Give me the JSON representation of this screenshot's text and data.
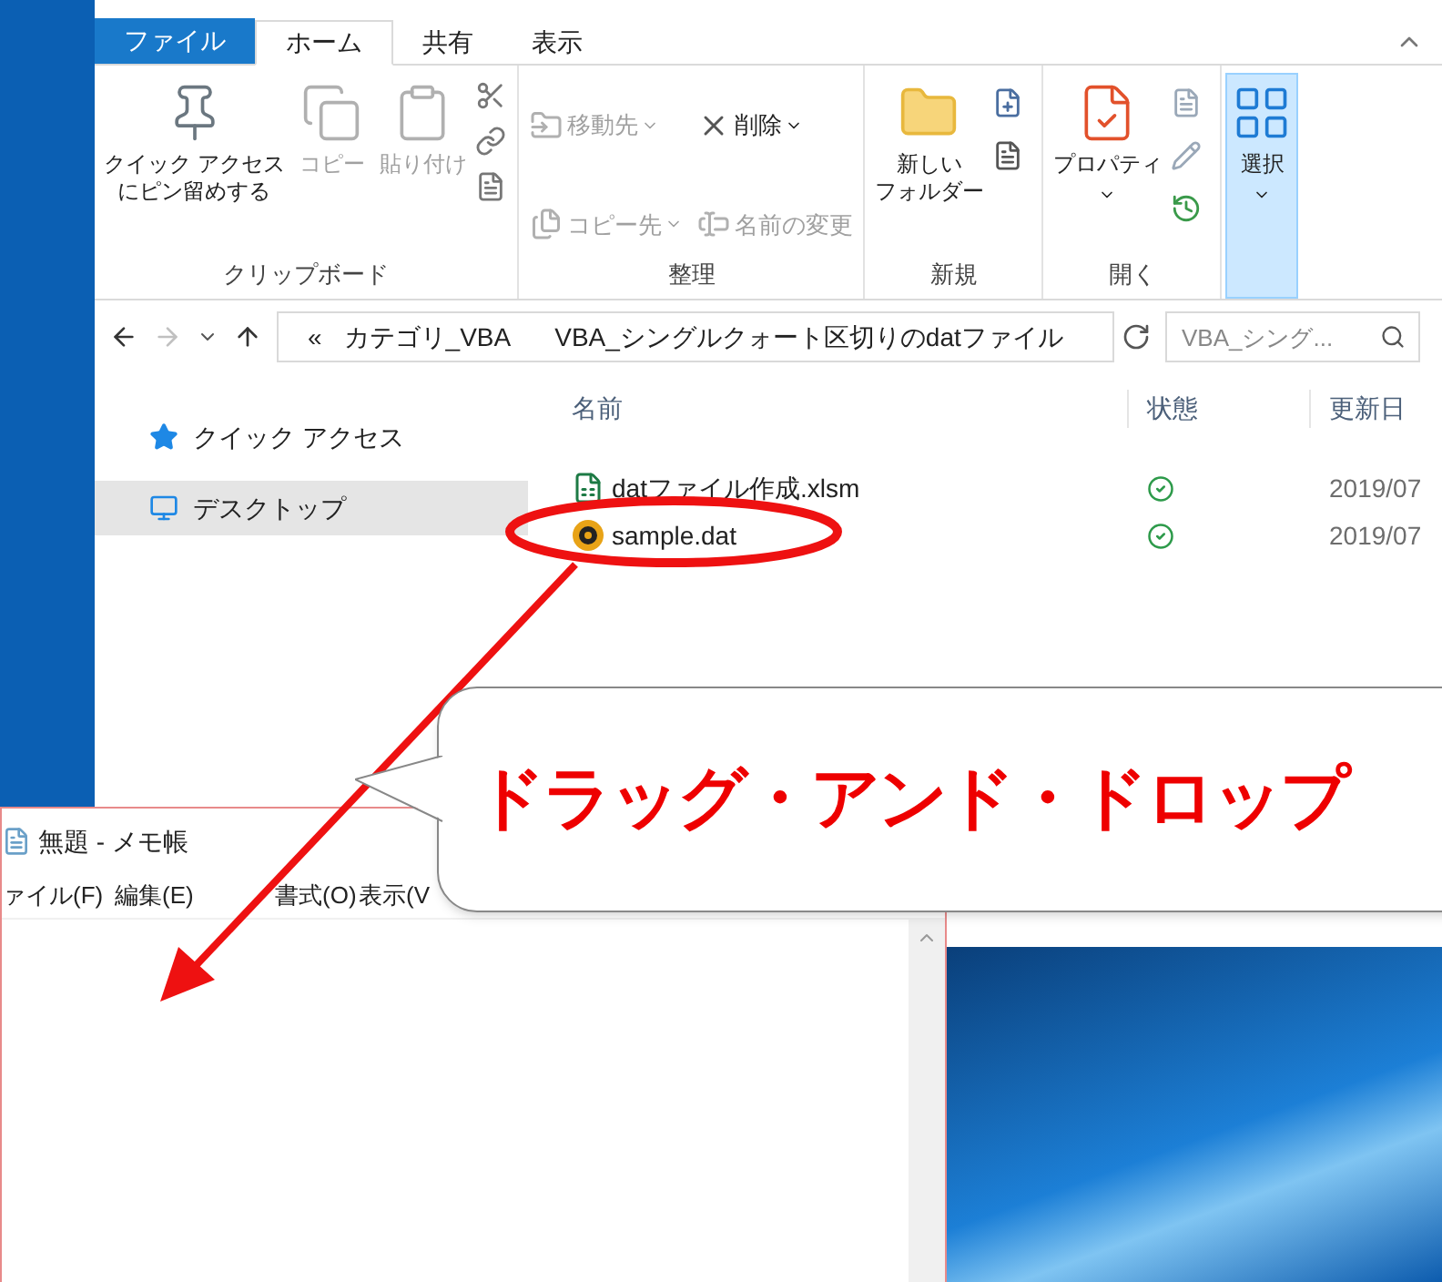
{
  "explorer": {
    "ribbon_tabs": [
      {
        "label": "ファイル",
        "kind": "file",
        "selected": false
      },
      {
        "label": "ホーム",
        "kind": "tab",
        "selected": true
      },
      {
        "label": "共有",
        "kind": "tab",
        "selected": false
      },
      {
        "label": "表示",
        "kind": "tab",
        "selected": false
      }
    ],
    "ribbon_groups": [
      {
        "label": "クリップボード",
        "buttons": [
          {
            "lines": [
              "クイック アクセス",
              "にピン留めする"
            ],
            "disabled": false
          },
          {
            "label": "コピー",
            "disabled": true
          },
          {
            "label": "貼り付け",
            "disabled": true
          }
        ]
      },
      {
        "label": "整理",
        "buttons": [
          {
            "label": "移動先",
            "disabled": true
          },
          {
            "label": "削除",
            "disabled": false
          },
          {
            "label": "コピー先",
            "disabled": true
          },
          {
            "label": "名前の変更",
            "disabled": true
          }
        ]
      },
      {
        "label": "新規",
        "buttons": [
          {
            "lines": [
              "新しい",
              "フォルダー"
            ],
            "disabled": false
          }
        ]
      },
      {
        "label": "開く",
        "buttons": [
          {
            "label": "プロパティ",
            "disabled": false
          }
        ]
      },
      {
        "buttons": [
          {
            "label": "選択",
            "disabled": false,
            "active": true
          }
        ]
      }
    ],
    "address": {
      "crumbs": [
        "«",
        "カテゴリ_VBA",
        "VBA_シングルクォート区切りのdatファイル"
      ]
    },
    "search": {
      "placeholder": "VBA_シング..."
    },
    "nav_items": [
      {
        "label": "クイック アクセス",
        "kind": "star",
        "selected": false
      },
      {
        "label": "デスクトップ",
        "kind": "desktop",
        "selected": true
      }
    ],
    "columns": [
      "名前",
      "状態",
      "更新日"
    ],
    "files": [
      {
        "name": "datファイル作成.xlsm",
        "kind": "excel",
        "synced": true,
        "date": "2019/07"
      },
      {
        "name": "sample.dat",
        "kind": "dat",
        "synced": true,
        "date": "2019/07"
      }
    ]
  },
  "notepad": {
    "title": "無題 - メモ帳",
    "menu": [
      "ァイル(F)",
      "編集(E)",
      "書式(O)",
      "表示(V"
    ]
  },
  "callout": {
    "text": "ドラッグ・アンド・ドロップ"
  }
}
